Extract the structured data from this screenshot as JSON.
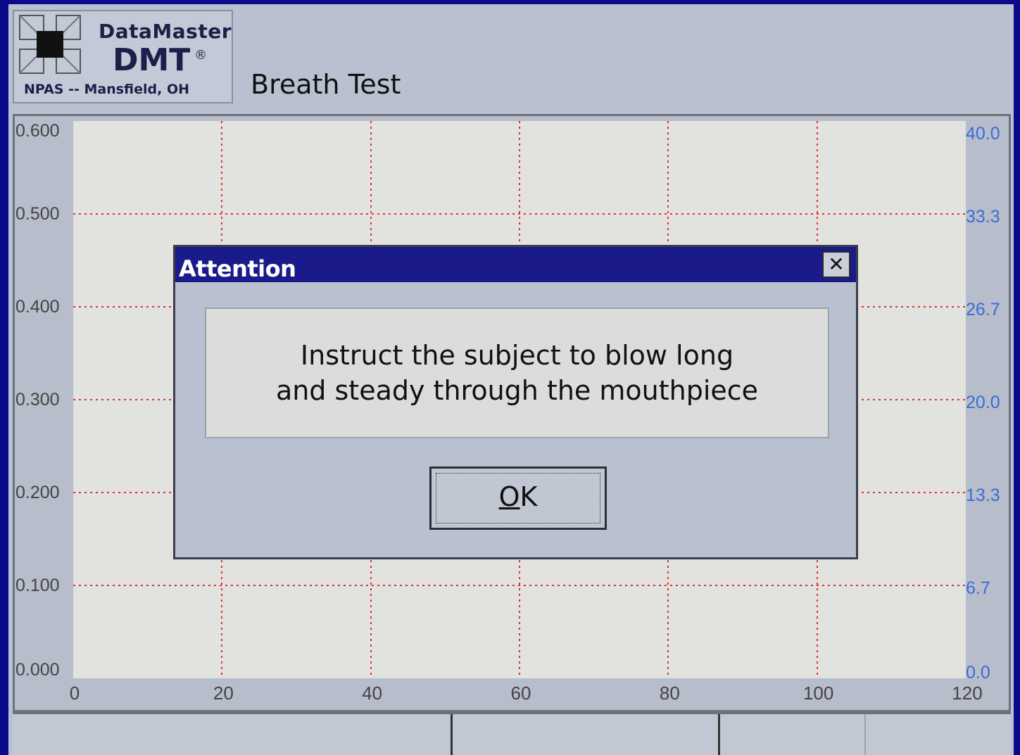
{
  "header": {
    "logo": {
      "line1": "DataMaster",
      "line2": "DMT",
      "registered": "®",
      "line3": "NPAS -- Mansfield, OH"
    },
    "title": "Breath Test"
  },
  "chart_data": {
    "type": "line",
    "title": "",
    "xlabel": "",
    "ylabel": "",
    "x_ticks": [
      "0",
      "20",
      "40",
      "60",
      "80",
      "100",
      "120"
    ],
    "xlim": [
      0,
      120
    ],
    "y_left_ticks": [
      "0.000",
      "0.100",
      "0.200",
      "0.300",
      "0.400",
      "0.500",
      "0.600"
    ],
    "ylim_left": [
      0,
      0.6
    ],
    "y_right_ticks": [
      "0.0",
      "6.7",
      "13.3",
      "20.0",
      "26.7",
      "33.3",
      "40.0"
    ],
    "ylim_right": [
      0,
      40
    ],
    "grid": true,
    "grid_color": "#e03030",
    "right_axis_color": "#3a6cd8",
    "series": []
  },
  "dialog": {
    "title": "Attention",
    "close_label": "✕",
    "message_line1": "Instruct the subject to blow long",
    "message_line2": "and steady through the mouthpiece",
    "ok_label_underlined": "O",
    "ok_label_rest": "K"
  },
  "colors": {
    "titlebar": "#1a1a8a",
    "screen_border": "#0a0a8c"
  }
}
